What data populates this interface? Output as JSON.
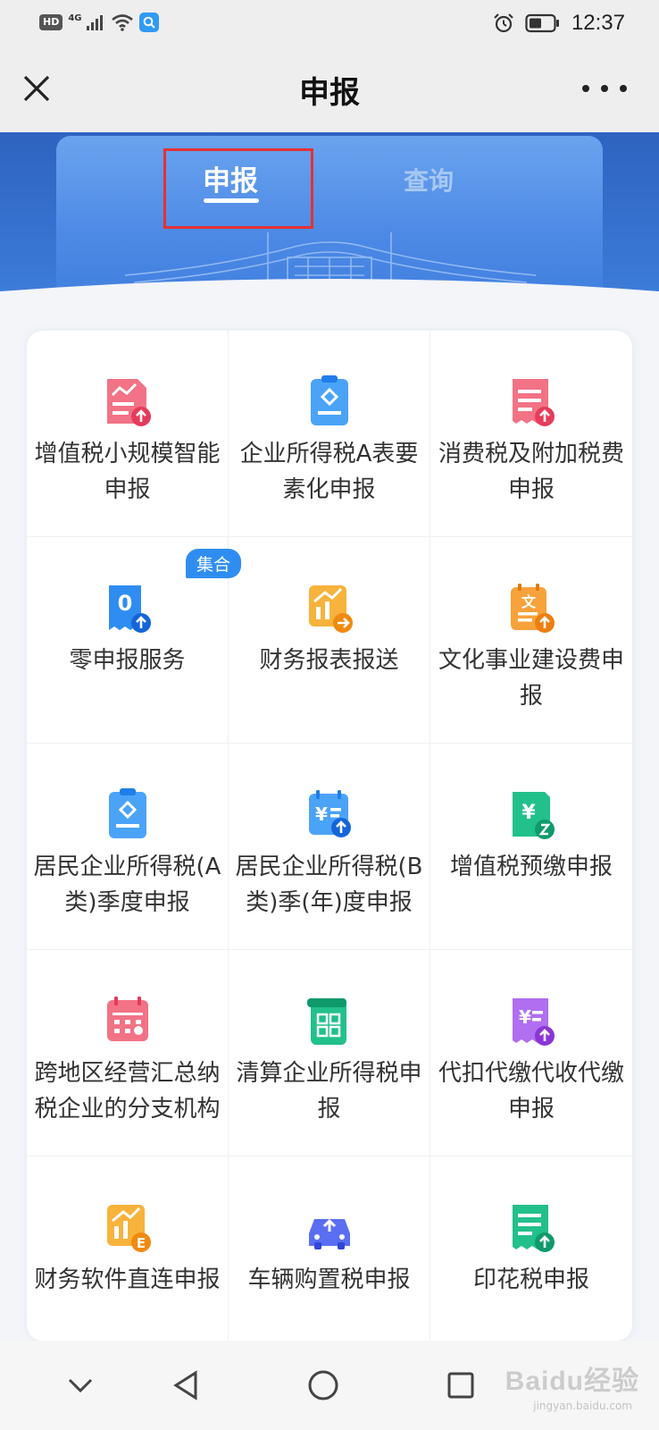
{
  "status_bar": {
    "hd": "HD",
    "network": "4G",
    "time": "12:37"
  },
  "header": {
    "title": "申报",
    "close_icon": "close-icon",
    "more_icon": "more-icon"
  },
  "tabs": {
    "declare": "申报",
    "query": "查询"
  },
  "grid": {
    "badge": "集合",
    "items": [
      {
        "label": "增值税小规模智能申报",
        "icon": "vat-small-icon",
        "color": "#ef4f6a"
      },
      {
        "label": "企业所得税A表要素化申报",
        "icon": "corp-tax-a-icon",
        "color": "#2f8df2"
      },
      {
        "label": "消费税及附加税费申报",
        "icon": "consumption-tax-icon",
        "color": "#ef4f6a"
      },
      {
        "label": "零申报服务",
        "icon": "zero-declare-icon",
        "color": "#2f8df2"
      },
      {
        "label": "财务报表报送",
        "icon": "financial-report-icon",
        "color": "#f59a1b"
      },
      {
        "label": "文化事业建设费申报",
        "icon": "culture-fee-icon",
        "color": "#f5871b"
      },
      {
        "label": "居民企业所得税(A类)季度申报",
        "icon": "resident-tax-a-icon",
        "color": "#2f8df2"
      },
      {
        "label": "居民企业所得税(B类)季(年)度申报",
        "icon": "resident-tax-b-icon",
        "color": "#2f8df2"
      },
      {
        "label": "增值税预缴申报",
        "icon": "vat-prepay-icon",
        "color": "#16b07e"
      },
      {
        "label": "跨地区经营汇总纳税企业的分支机构",
        "icon": "cross-region-icon",
        "color": "#ef4f6a"
      },
      {
        "label": "清算企业所得税申报",
        "icon": "liquidation-tax-icon",
        "color": "#16b07e"
      },
      {
        "label": "代扣代缴代收代缴申报",
        "icon": "withholding-icon",
        "color": "#9b4fe0"
      },
      {
        "label": "财务软件直连申报",
        "icon": "software-direct-icon",
        "color": "#f59a1b"
      },
      {
        "label": "车辆购置税申报",
        "icon": "vehicle-tax-icon",
        "color": "#4a5ef0"
      },
      {
        "label": "印花税申报",
        "icon": "stamp-tax-icon",
        "color": "#16b07e"
      }
    ]
  },
  "nav": {
    "back": "back-icon",
    "home": "home-icon",
    "recents": "recents-icon",
    "down": "chevron-down-icon"
  },
  "watermark": {
    "brand": "Baidu经验",
    "url": "jingyan.baidu.com"
  }
}
